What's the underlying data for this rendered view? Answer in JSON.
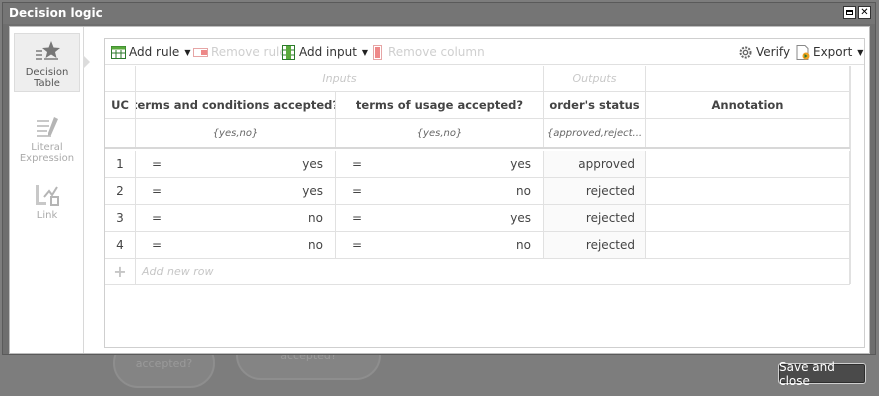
{
  "dialog": {
    "title": "Decision logic"
  },
  "background": {
    "shape1_label": "accepted?",
    "shape2_label": "accepted?"
  },
  "sidebar": {
    "items": [
      {
        "label": "Decision Table",
        "icon": "star-table-icon",
        "active": true
      },
      {
        "label": "Literal Expression",
        "icon": "pencil-lines-icon",
        "active": false
      },
      {
        "label": "Link",
        "icon": "link-doc-icon",
        "active": false
      }
    ]
  },
  "toolbar": {
    "add_rule": "Add rule",
    "remove_rule": "Remove rule",
    "add_input": "Add input",
    "remove_column": "Remove column",
    "verify": "Verify",
    "export": "Export"
  },
  "table": {
    "inputs_group": "Inputs",
    "outputs_group": "Outputs",
    "uc_header": "UC",
    "columns": [
      "terms and conditions accepted?",
      "terms of usage accepted?",
      "order's status",
      "Annotation"
    ],
    "domains": [
      "{yes,no}",
      "{yes,no}",
      "{approved,reject..."
    ],
    "rows": [
      {
        "num": "1",
        "op1": "=",
        "v1": "yes",
        "op2": "=",
        "v2": "yes",
        "out": "approved",
        "annotation": ""
      },
      {
        "num": "2",
        "op1": "=",
        "v1": "yes",
        "op2": "=",
        "v2": "no",
        "out": "rejected",
        "annotation": ""
      },
      {
        "num": "3",
        "op1": "=",
        "v1": "no",
        "op2": "=",
        "v2": "yes",
        "out": "rejected",
        "annotation": ""
      },
      {
        "num": "4",
        "op1": "=",
        "v1": "no",
        "op2": "=",
        "v2": "no",
        "out": "rejected",
        "annotation": ""
      }
    ],
    "add_row_symbol": "+",
    "add_row_label": "Add new row"
  },
  "footer": {
    "save_close": "Save and close"
  }
}
